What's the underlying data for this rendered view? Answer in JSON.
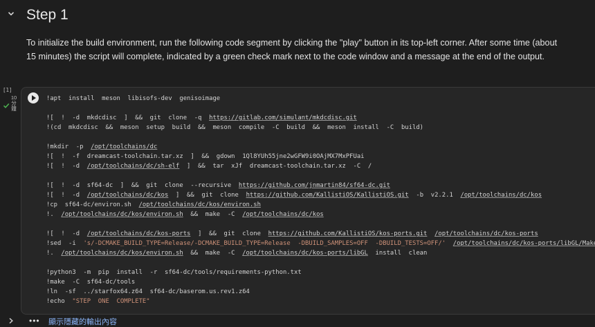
{
  "heading": {
    "title": "Step 1"
  },
  "intro_text": "To initialize the build environment, run the following code segment by clicking the \"play\" button in its top-left corner. After some time (about 15 minutes) the script will complete, indicated by a green check mark next to the code window and a message at the end of the output.",
  "cell": {
    "exec_count": "[1]",
    "exec_time_value": "10",
    "exec_time_unit1": "分",
    "exec_time_unit2": "鐘",
    "status_color": "#4caf50",
    "run_icon": "play-icon",
    "code_lines": [
      [
        {
          "t": "!apt  install  meson  libisofs-dev  genisoimage"
        }
      ],
      [],
      [
        {
          "t": "![  !  -d  mkdcdisc  ]  &&  git  clone  -q  "
        },
        {
          "t": "https://gitlab.com/simulant/mkdcdisc.git",
          "k": "url"
        }
      ],
      [
        {
          "t": "!(cd  mkdcdisc  &&  meson  setup  build  &&  meson  compile  -C  build  &&  meson  install  -C  build)"
        }
      ],
      [],
      [
        {
          "t": "!mkdir  -p  "
        },
        {
          "t": "/opt/toolchains/dc",
          "k": "url"
        }
      ],
      [
        {
          "t": "![  !  -f  dreamcast-toolchain.tar.xz  ]  &&  gdown  1Ql8YUh55jne2wGFW9i0OAjMX7MxPFUai"
        }
      ],
      [
        {
          "t": "![  !  -d  "
        },
        {
          "t": "/opt/toolchains/dc/sh-elf",
          "k": "url"
        },
        {
          "t": "  ]  &&  tar  xJf  dreamcast-toolchain.tar.xz  -C  /"
        }
      ],
      [],
      [
        {
          "t": "![  !  -d  sf64-dc  ]  &&  git  clone  --recursive  "
        },
        {
          "t": "https://github.com/jnmartin84/sf64-dc.git",
          "k": "url"
        }
      ],
      [
        {
          "t": "![  !  -d  "
        },
        {
          "t": "/opt/toolchains/dc/kos",
          "k": "url"
        },
        {
          "t": "  ]  &&  git  clone  "
        },
        {
          "t": "https://github.com/KallistiOS/KallistiOS.git",
          "k": "url"
        },
        {
          "t": "  -b  v2.2.1  "
        },
        {
          "t": "/opt/toolchains/dc/kos",
          "k": "url"
        }
      ],
      [
        {
          "t": "!cp  sf64-dc/environ.sh  "
        },
        {
          "t": "/opt/toolchains/dc/kos/environ.sh",
          "k": "url"
        }
      ],
      [
        {
          "t": "!.  "
        },
        {
          "t": "/opt/toolchains/dc/kos/environ.sh",
          "k": "url"
        },
        {
          "t": "  &&  make  -C  "
        },
        {
          "t": "/opt/toolchains/dc/kos",
          "k": "url"
        }
      ],
      [],
      [
        {
          "t": "![  !  -d  "
        },
        {
          "t": "/opt/toolchains/dc/kos-ports",
          "k": "url"
        },
        {
          "t": "  ]  &&  git  clone  "
        },
        {
          "t": "https://github.com/KallistiOS/kos-ports.git",
          "k": "url"
        },
        {
          "t": "  "
        },
        {
          "t": "/opt/toolchains/dc/kos-ports",
          "k": "url"
        }
      ],
      [
        {
          "t": "!sed  -i  "
        },
        {
          "t": "'s/-DCMAKE_BUILD_TYPE=Release/-DCMAKE_BUILD_TYPE=Release  -DBUILD_SAMPLES=OFF  -DBUILD_TESTS=OFF/'",
          "k": "str"
        },
        {
          "t": "  "
        },
        {
          "t": "/opt/toolchains/dc/kos-ports/libGL/Makefile",
          "k": "url"
        }
      ],
      [
        {
          "t": "!.  "
        },
        {
          "t": "/opt/toolchains/dc/kos/environ.sh",
          "k": "url"
        },
        {
          "t": "  &&  make  -C  "
        },
        {
          "t": "/opt/toolchains/dc/kos-ports/libGL",
          "k": "url"
        },
        {
          "t": "  install  clean"
        }
      ],
      [],
      [
        {
          "t": "!python3  -m  pip  install  -r  sf64-dc/tools/requirements-python.txt"
        }
      ],
      [
        {
          "t": "!make  -C  sf64-dc/tools"
        }
      ],
      [
        {
          "t": "!ln  -sf  ../starfox64.z64  sf64-dc/baserom.us.rev1.z64"
        }
      ],
      [
        {
          "t": "!echo  "
        },
        {
          "t": "\"STEP  ONE  COMPLETE\"",
          "k": "str"
        }
      ]
    ]
  },
  "output_bar": {
    "more_icon": "more-horiz-icon",
    "more_glyph": "•••",
    "link_label": "顯示隱藏的輸出內容",
    "link_color": "#8ab4f8"
  }
}
